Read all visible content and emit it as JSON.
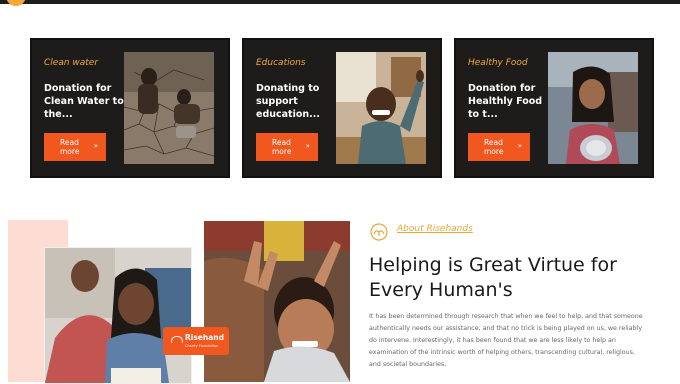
{
  "cards": [
    {
      "category": "Clean water",
      "description": "Donation for Clean Water to the...",
      "button": "Read more",
      "arrow": "»",
      "image": "cracked-earth-children-photo"
    },
    {
      "category": "Educations",
      "description": "Donating to support education...",
      "button": "Read more",
      "arrow": "»",
      "image": "smiling-boy-classroom-photo"
    },
    {
      "category": "Healthy Food",
      "description": "Donation for Healthly Food to t...",
      "button": "Read more",
      "arrow": "»",
      "image": "girl-with-bowl-photo"
    }
  ],
  "about": {
    "tag": "About Risehands",
    "heading": "Helping is Great Virtue for Every Human's",
    "paragraph": "It has been determined through research that when we feel to help, and that someone authentically needs our assistance, and that no trick is being played on us, we reliably do intervene. Interestingly, it has been found that we are less likely to help an examination of the intrinsic worth of helping others, transcending cultural, religious, and societal boundaries.",
    "logo": {
      "name": "Risehand",
      "subtitle": "Charity Foundation"
    }
  },
  "colors": {
    "accent": "#f0581f",
    "gold": "#f2a93b",
    "card_bg": "#1e1c1b",
    "pink": "#fcdcd3"
  }
}
